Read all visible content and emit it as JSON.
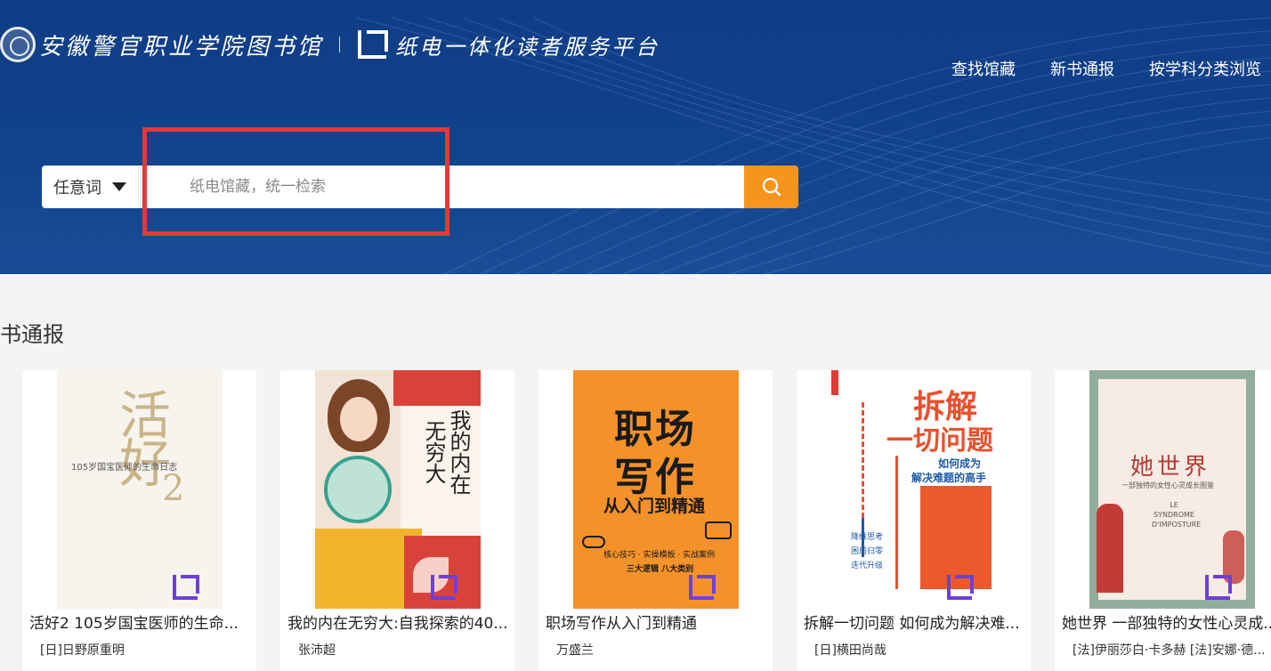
{
  "header": {
    "school_name": "安徽警官职业学院图书馆",
    "platform_name": "纸电一体化读者服务平台"
  },
  "nav": {
    "items": [
      "查找馆藏",
      "新书通报",
      "按学科分类浏览"
    ]
  },
  "search": {
    "type_selected": "任意词",
    "placeholder": "纸电馆藏，统一检索"
  },
  "section": {
    "title": "书通报"
  },
  "books": [
    {
      "title": "活好2 105岁国宝医师的生命...",
      "author": "[日]日野原重明",
      "cover": {
        "big": "活好",
        "num": "2",
        "sub": "105岁国宝医师的生命日志"
      }
    },
    {
      "title": "我的内在无穷大:自我探索的40...",
      "author": "张沛超",
      "cover": {
        "line1": "我的内在",
        "line2": "无穷大"
      }
    },
    {
      "title": "职场写作从入门到精通",
      "author": "万盛兰",
      "cover": {
        "line1": "职场",
        "line2": "写作",
        "line3": "从入门到精通",
        "tag1": "核心技巧 · 实操模板 · 实战案例",
        "tag2": "三大逻辑 八大类别"
      }
    },
    {
      "title": "拆解一切问题 如何成为解决难...",
      "author": "[日]横田尚哉",
      "cover": {
        "line1": "拆解",
        "line2": "一切问题",
        "line3": "如何成为",
        "line4": "解决难题的高手",
        "s1": "降维思考",
        "s2": "困局归零",
        "s3": "迭代升级"
      }
    },
    {
      "title": "她世界 一部独特的女性心灵成...",
      "author": "[法]伊丽莎白·卡多赫 [法]安娜·德...",
      "cover": {
        "line1": "她世界",
        "line2": "一部独特的女性心灵成长图鉴",
        "line3": "LE SYNDROME D'IMPOSTURE"
      }
    }
  ],
  "colors": {
    "header_bg": "#0f3d86",
    "search_button": "#f7941d",
    "highlight": "#e53935",
    "watermark": "#6e3fd8"
  }
}
